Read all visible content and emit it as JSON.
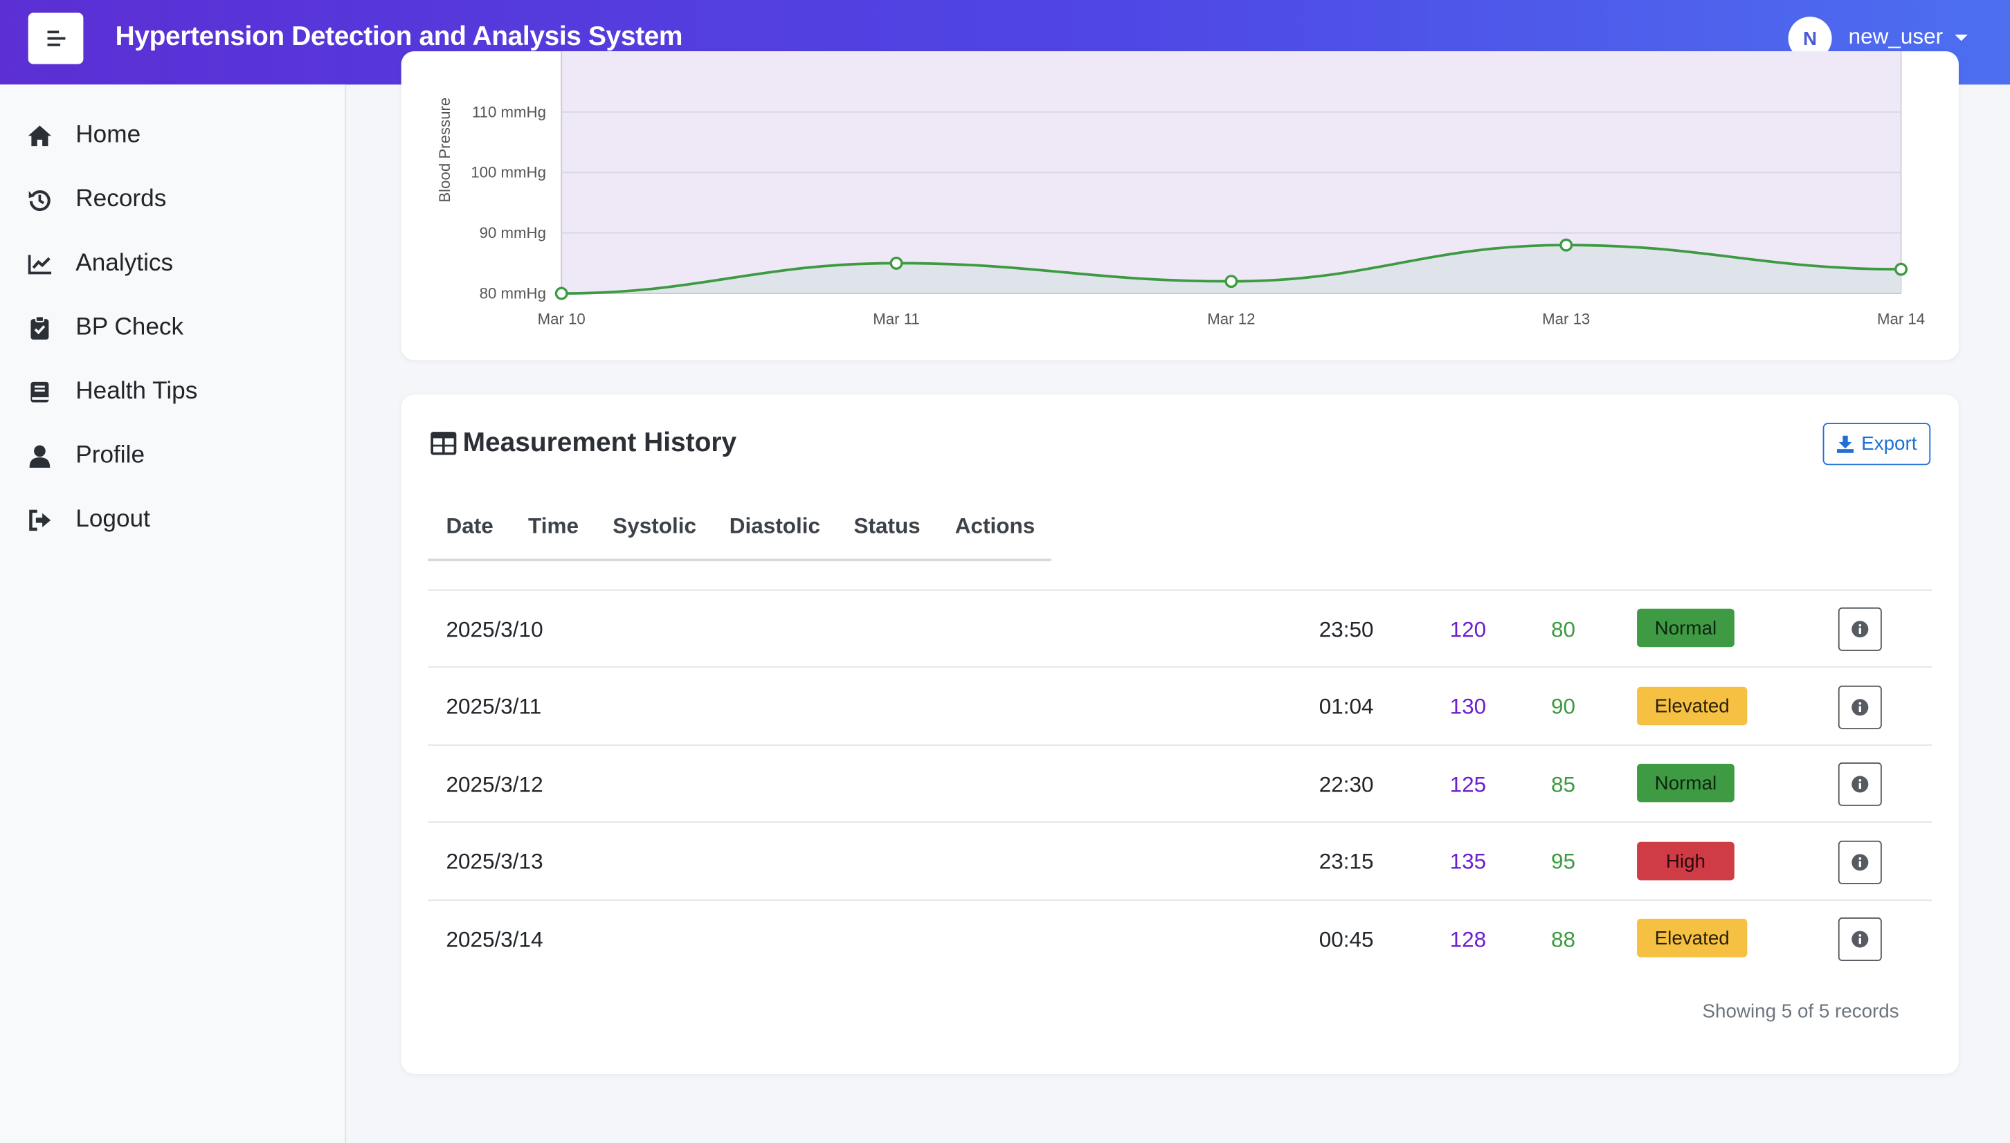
{
  "header": {
    "title": "Hypertension Detection and Analysis System",
    "avatar_initial": "N",
    "username": "new_user",
    "menu_icon": "menu-icon",
    "caret_icon": "caret-down-icon"
  },
  "sidebar": {
    "items": [
      {
        "label": "Home",
        "icon": "home-icon"
      },
      {
        "label": "Records",
        "icon": "history-icon"
      },
      {
        "label": "Analytics",
        "icon": "chart-line-icon"
      },
      {
        "label": "BP Check",
        "icon": "clipboard-check-icon"
      },
      {
        "label": "Health Tips",
        "icon": "book-icon"
      },
      {
        "label": "Profile",
        "icon": "user-icon"
      },
      {
        "label": "Logout",
        "icon": "sign-out-icon"
      }
    ]
  },
  "chart_data": {
    "type": "area",
    "title": "",
    "xlabel": "",
    "ylabel": "Blood Pressure",
    "categories": [
      "Mar 10",
      "Mar 11",
      "Mar 12",
      "Mar 13",
      "Mar 14"
    ],
    "y_ticks": [
      "80 mmHg",
      "90 mmHg",
      "100 mmHg",
      "110 mmHg"
    ],
    "ylim": [
      80,
      110
    ],
    "grid": true,
    "series": [
      {
        "values": [
          80,
          85,
          82,
          88,
          84
        ],
        "color": "#3c9a40",
        "fill": "#dfe3ea"
      }
    ],
    "upper_fill_color": "#efe8f7"
  },
  "history": {
    "title": "Measurement History",
    "title_icon": "table-icon",
    "export_label": "Export",
    "export_icon": "download-icon",
    "columns": [
      "Date",
      "Time",
      "Systolic",
      "Diastolic",
      "Status",
      "Actions"
    ],
    "rows": [
      {
        "date": "2025/3/10",
        "time": "23:50",
        "systolic": "120",
        "diastolic": "80",
        "status": "Normal"
      },
      {
        "date": "2025/3/11",
        "time": "01:04",
        "systolic": "130",
        "diastolic": "90",
        "status": "Elevated"
      },
      {
        "date": "2025/3/12",
        "time": "22:30",
        "systolic": "125",
        "diastolic": "85",
        "status": "Normal"
      },
      {
        "date": "2025/3/13",
        "time": "23:15",
        "systolic": "135",
        "diastolic": "95",
        "status": "High"
      },
      {
        "date": "2025/3/14",
        "time": "00:45",
        "systolic": "128",
        "diastolic": "88",
        "status": "Elevated"
      }
    ],
    "action_icon": "info-circle-icon",
    "footer": "Showing 5 of 5 records"
  },
  "colors": {
    "header_gradient_start": "#5b2fd4",
    "header_gradient_end": "#4d6ff0",
    "primary": "#1f6fd6",
    "systolic": "#6b1fd0",
    "diastolic": "#3c9a40",
    "status_normal": "#3e9b44",
    "status_elevated": "#f6c142",
    "status_high": "#d03c45"
  }
}
